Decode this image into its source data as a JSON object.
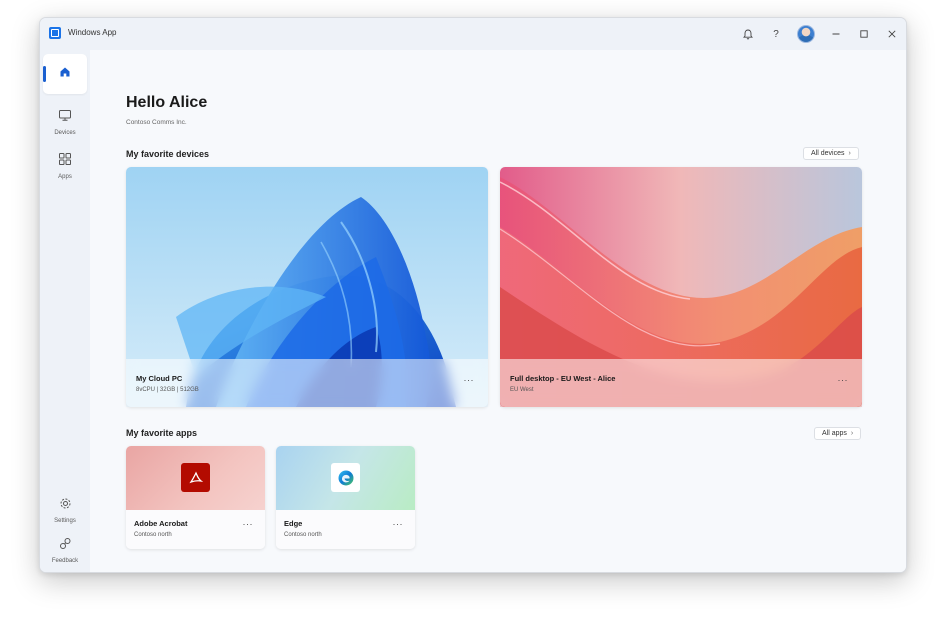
{
  "window": {
    "title": "Windows App"
  },
  "titlebar": {
    "icons": [
      "bell-icon",
      "help-icon",
      "avatar",
      "minimize-icon",
      "maximize-icon",
      "close-icon"
    ],
    "help_glyph": "?"
  },
  "sidebar": {
    "items": [
      {
        "id": "home",
        "label": "",
        "icon": "home-icon",
        "active": true
      },
      {
        "id": "devices",
        "label": "Devices",
        "icon": "monitor-icon"
      },
      {
        "id": "apps",
        "label": "Apps",
        "icon": "apps-grid-icon"
      }
    ],
    "bottom_items": [
      {
        "id": "settings",
        "label": "Settings",
        "icon": "gear-icon"
      },
      {
        "id": "feedback",
        "label": "Feedback",
        "icon": "feedback-icon"
      }
    ]
  },
  "main": {
    "greeting": "Hello Alice",
    "organization": "Contoso Comms Inc.",
    "devices_section": {
      "title": "My favorite devices",
      "link": "All devices",
      "cards": [
        {
          "name": "My Cloud PC",
          "subtitle": "8vCPU | 32GB | 512GB",
          "more": "···",
          "wallpaper": "blue-bloom"
        },
        {
          "name": "Full desktop - EU West - Alice",
          "subtitle": "EU West",
          "more": "···",
          "wallpaper": "coral-waves"
        }
      ]
    },
    "apps_section": {
      "title": "My favorite apps",
      "link": "All apps",
      "cards": [
        {
          "name": "Adobe Acrobat",
          "subtitle": "Contoso north",
          "more": "···",
          "icon": "adobe-acrobat-icon",
          "accent": "#b30b00"
        },
        {
          "name": "Edge",
          "subtitle": "Contoso north",
          "more": "···",
          "icon": "edge-icon",
          "accent": "#0f7bd4"
        }
      ]
    }
  },
  "colors": {
    "accent": "#1a5fd0",
    "window_bg": "#f7f9fc",
    "sidebar_bg": "#eef2f8"
  }
}
